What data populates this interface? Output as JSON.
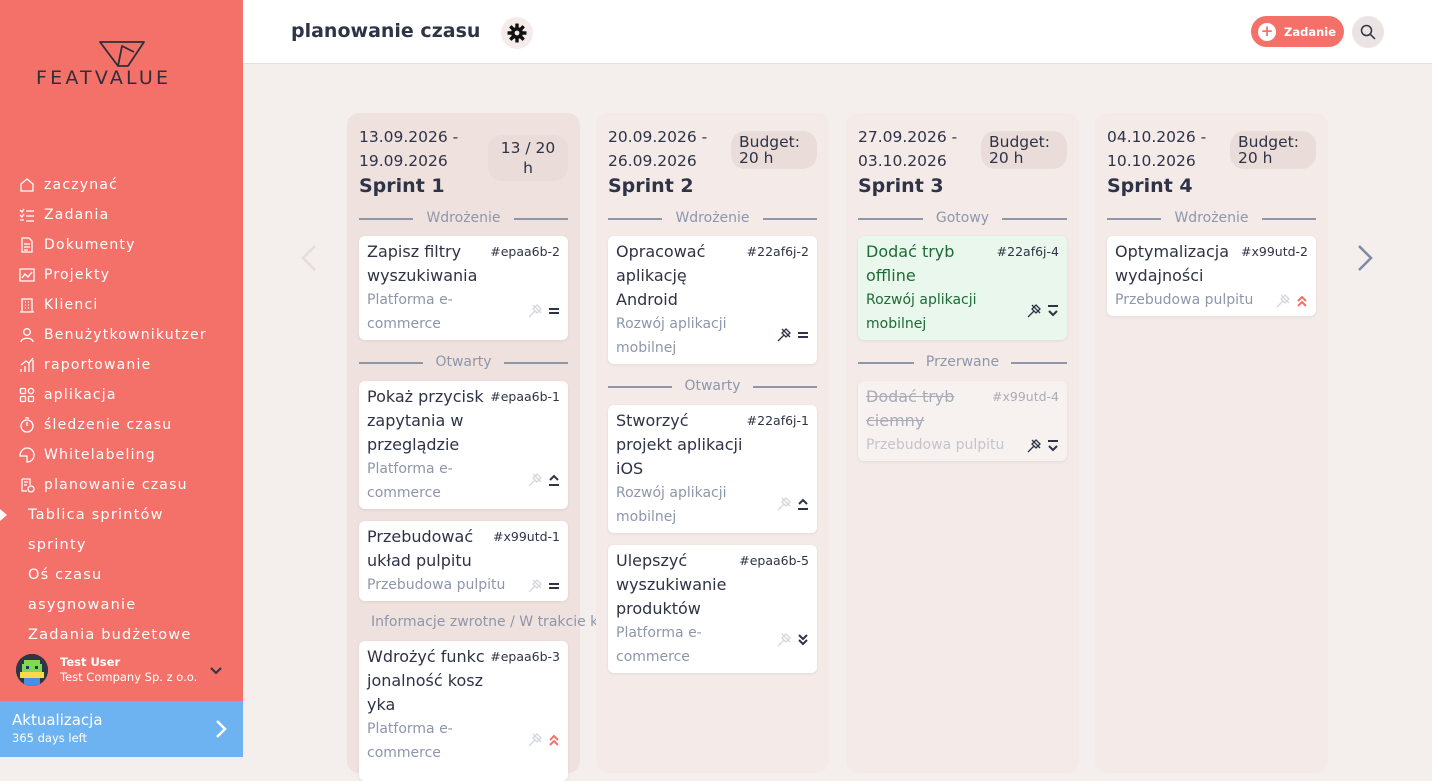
{
  "brand": {
    "logo_text": "FEATVALUE"
  },
  "sidebar": {
    "items": [
      {
        "label": "zaczynać",
        "icon": "home-icon"
      },
      {
        "label": "Zadania",
        "icon": "checklist-icon"
      },
      {
        "label": "Dokumenty",
        "icon": "documents-icon"
      },
      {
        "label": "Projekty",
        "icon": "projects-icon"
      },
      {
        "label": "Klienci",
        "icon": "building-icon"
      },
      {
        "label": "Benużytkownikutzer",
        "icon": "user-icon"
      },
      {
        "label": "raportowanie",
        "icon": "chart-icon"
      },
      {
        "label": "aplikacja",
        "icon": "apps-icon"
      },
      {
        "label": "śledzenie czasu",
        "icon": "stopwatch-icon"
      },
      {
        "label": "Whitelabeling",
        "icon": "tag-icon"
      },
      {
        "label": "planowanie czasu",
        "icon": "calendar-clock-icon"
      }
    ],
    "sub_items": [
      {
        "label": "Tablica sprintów",
        "active": true
      },
      {
        "label": "sprinty"
      },
      {
        "label": "Oś czasu"
      },
      {
        "label": "asygnowanie"
      },
      {
        "label": "Zadania budżetowe"
      }
    ],
    "user": {
      "name": "Test User",
      "company": "Test Company Sp. z o.o."
    },
    "upgrade": {
      "title": "Aktualizacja",
      "subtitle": "365 days left"
    }
  },
  "header": {
    "title": "planowanie czasu",
    "add_task_label": "Zadanie"
  },
  "colors": {
    "sidebar": "#f4716a",
    "accent": "#f4716a",
    "upgrade": "#6db3f2",
    "done_card": "#e9f7ec",
    "priority_high": "#f4716a"
  },
  "sprints": [
    {
      "dates_line1": "13.09.2026 -",
      "dates_line2": "19.09.2026",
      "name": "Sprint 1",
      "budget": "13 / 20 h",
      "groups": [
        {
          "label": "Wdrożenie",
          "cards": [
            {
              "title": "Zapisz filtry wyszukiwania",
              "id": "#epaa6b-2",
              "project": "Platforma e-commerce",
              "priority": "equal-priority-icon"
            }
          ]
        },
        {
          "label": "Otwarty",
          "cards": [
            {
              "title": "Pokaż przycisk zapytania w przeglądzie",
              "id": "#epaa6b-1",
              "project": "Platforma e-commerce",
              "priority": "priority-up-icon"
            },
            {
              "title": "Przebudować układ pulpitu",
              "id": "#x99utd-1",
              "project": "Przebudowa pulpitu",
              "priority": "equal-priority-icon"
            }
          ]
        },
        {
          "label": "Informacje zwrotne / W trakcie k",
          "cards": [
            {
              "title": "Wdrożyć funkcjonalność koszyka",
              "id": "#epaa6b-3",
              "project": "Platforma e-commerce",
              "priority": "double-up-icon"
            }
          ]
        }
      ]
    },
    {
      "dates_line1": "20.09.2026 -",
      "dates_line2": "26.09.2026",
      "name": "Sprint 2",
      "budget": "Budget: 20 h",
      "groups": [
        {
          "label": "Wdrożenie",
          "cards": [
            {
              "title": "Opracować aplikację Android",
              "id": "#22af6j-2",
              "project": "Rozwój aplikacji mobilnej",
              "priority": "equal-priority-icon"
            }
          ]
        },
        {
          "label": "Otwarty",
          "cards": [
            {
              "title": "Stworzyć projekt aplikacji iOS",
              "id": "#22af6j-1",
              "project": "Rozwój aplikacji mobilnej",
              "priority": "priority-up-icon"
            },
            {
              "title": "Ulepszyć wyszukiwanie produktów",
              "id": "#epaa6b-5",
              "project": "Platforma e-commerce",
              "priority": "double-down-icon"
            }
          ]
        }
      ]
    },
    {
      "dates_line1": "27.09.2026 -",
      "dates_line2": "03.10.2026",
      "name": "Sprint 3",
      "budget": "Budget: 20 h",
      "groups": [
        {
          "label": "Gotowy",
          "cards": [
            {
              "title": "Dodać tryb offline",
              "id": "#22af6j-4",
              "project": "Rozwój aplikacji mobilnej",
              "priority": "priority-down-icon"
            }
          ]
        },
        {
          "label": "Przerwane",
          "cards": [
            {
              "title": "Dodać tryb ciemny",
              "id": "#x99utd-4",
              "project": "Przebudowa pulpitu",
              "priority": "priority-down-icon"
            }
          ]
        }
      ]
    },
    {
      "dates_line1": "04.10.2026 -",
      "dates_line2": "10.10.2026",
      "name": "Sprint 4",
      "budget": "Budget: 20 h",
      "groups": [
        {
          "label": "Wdrożenie",
          "cards": [
            {
              "title": "Optymalizacja wydajności",
              "id": "#x99utd-2",
              "project": "Przebudowa pulpitu",
              "priority": "double-up-icon"
            }
          ]
        }
      ]
    }
  ]
}
